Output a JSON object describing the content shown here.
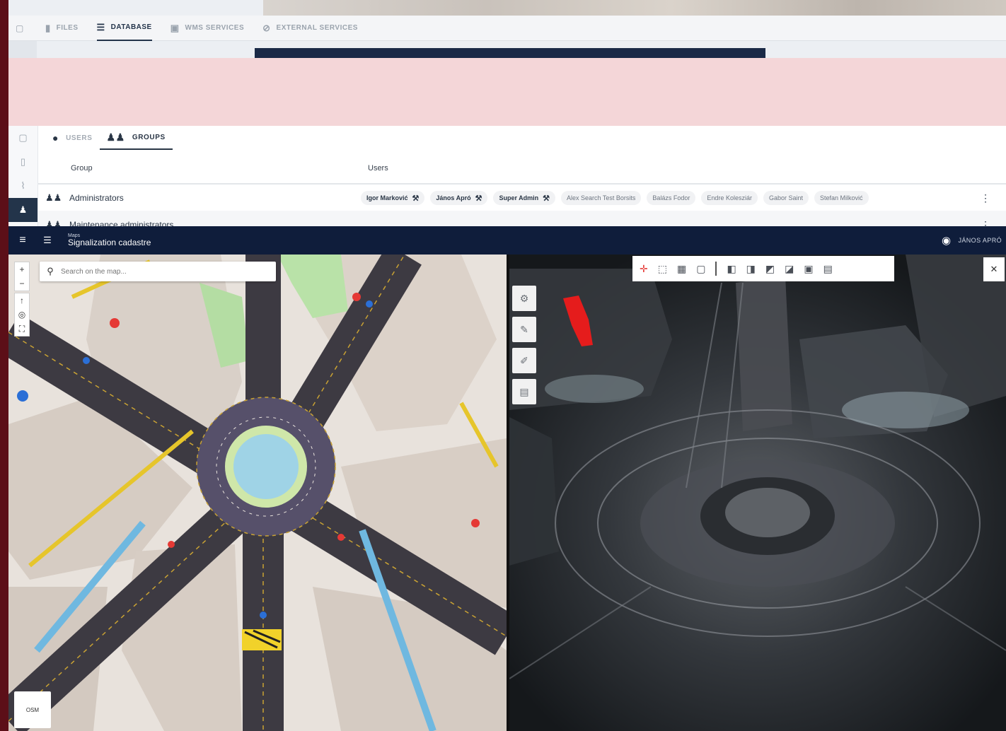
{
  "files_panel": {
    "tabs": [
      {
        "icon": "file-icon",
        "label": "FILES",
        "active": false
      },
      {
        "icon": "database-icon",
        "label": "DATABASE",
        "active": true
      },
      {
        "icon": "map-layers-icon",
        "label": "WMS SERVICES",
        "active": false
      },
      {
        "icon": "link-icon",
        "label": "EXTERNAL SERVICES",
        "active": false
      }
    ]
  },
  "groups_panel": {
    "tabs": [
      {
        "icon": "person-icon",
        "label": "USERS",
        "active": false
      },
      {
        "icon": "group-icon",
        "label": "GROUPS",
        "active": true
      }
    ],
    "columns": {
      "group": "Group",
      "users": "Users"
    },
    "rows": [
      {
        "name": "Administrators",
        "users": [
          {
            "name": "Igor Marković",
            "admin": true
          },
          {
            "name": "János Apró",
            "admin": true
          },
          {
            "name": "Super Admin",
            "admin": true
          },
          {
            "name": "Alex Search Test Borsits",
            "admin": false
          },
          {
            "name": "Balázs Fodor",
            "admin": false
          },
          {
            "name": "Endre Kolesziár",
            "admin": false
          },
          {
            "name": "Gabor Saint",
            "admin": false
          },
          {
            "name": "Stefan Milković",
            "admin": false
          }
        ]
      },
      {
        "name": "Maintenance administrators",
        "users": []
      }
    ]
  },
  "app": {
    "breadcrumb": "Maps",
    "title": "Signalization cadastre",
    "user": "JÁNOS APRÓ",
    "search": {
      "placeholder": "Search on the map..."
    },
    "basemap_button": "OSM",
    "colors": {
      "appbar": "#0f1d3b",
      "accent": "#e53935"
    }
  }
}
